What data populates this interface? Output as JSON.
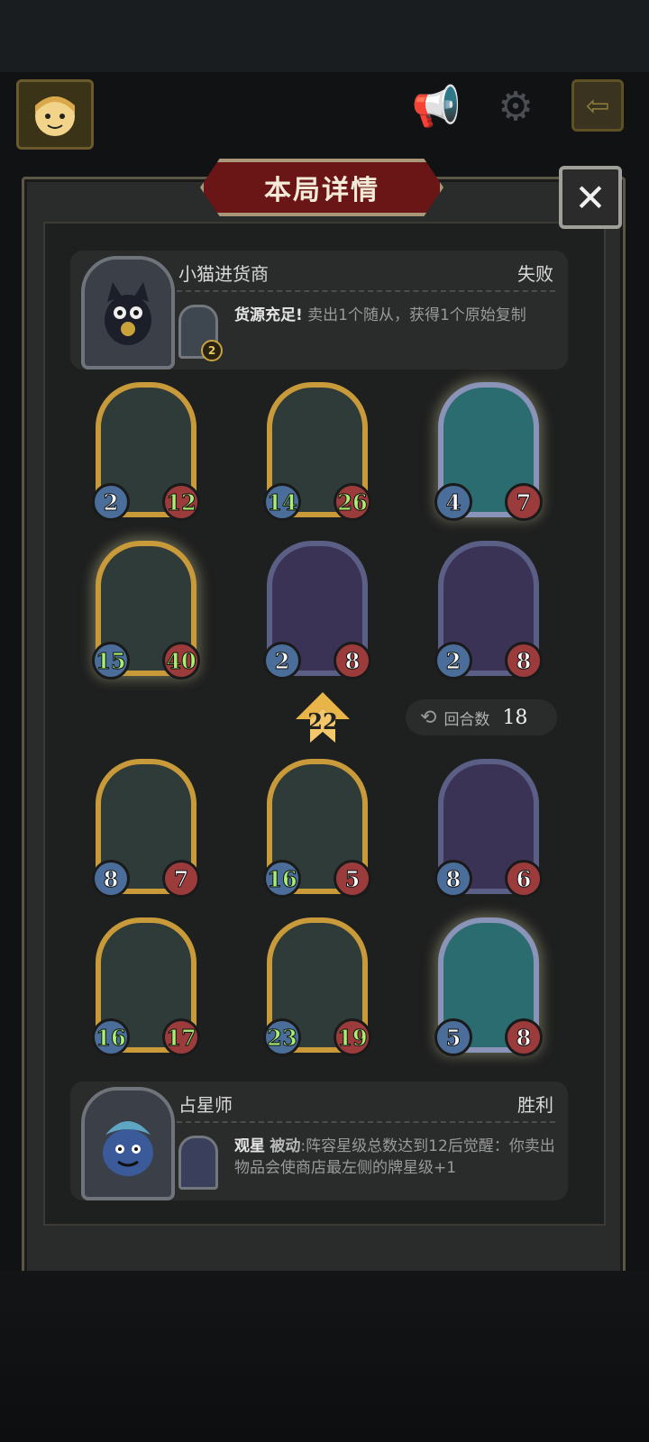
{
  "header": {
    "title": "本局详情",
    "close_icon": "✕"
  },
  "opponent": {
    "name": "小猫进货商",
    "result": "失败",
    "item_level": "2",
    "skill_title": "货源充足!",
    "skill_desc": "卖出1个随从，获得1个原始复制"
  },
  "opponent_cards": [
    {
      "atk": "2",
      "hp": "12",
      "style": "gold"
    },
    {
      "atk": "14",
      "hp": "26",
      "style": "gold"
    },
    {
      "atk": "4",
      "hp": "7",
      "style": "diamond"
    },
    {
      "atk": "15",
      "hp": "40",
      "style": "gold-glow"
    },
    {
      "atk": "2",
      "hp": "8",
      "style": "silver"
    },
    {
      "atk": "2",
      "hp": "8",
      "style": "silver"
    }
  ],
  "rank": "22",
  "rounds": {
    "label": "回合数",
    "value": "18"
  },
  "player_cards": [
    {
      "atk": "8",
      "hp": "7",
      "style": "gold"
    },
    {
      "atk": "16",
      "hp": "5",
      "style": "gold"
    },
    {
      "atk": "8",
      "hp": "6",
      "style": "silver"
    },
    {
      "atk": "16",
      "hp": "17",
      "style": "gold"
    },
    {
      "atk": "23",
      "hp": "19",
      "style": "gold"
    },
    {
      "atk": "5",
      "hp": "8",
      "style": "diamond"
    }
  ],
  "player": {
    "name": "占星师",
    "result": "胜利",
    "skill_name": "观星",
    "skill_type": "被动",
    "skill_desc": ":阵容星级总数达到12后觉醒：你卖出物品会使商店最左侧的牌星级+1"
  },
  "colors": {
    "gold_frame": "#c89a3a",
    "silver_frame": "#5b5f86",
    "title_red": "#6a1617"
  }
}
